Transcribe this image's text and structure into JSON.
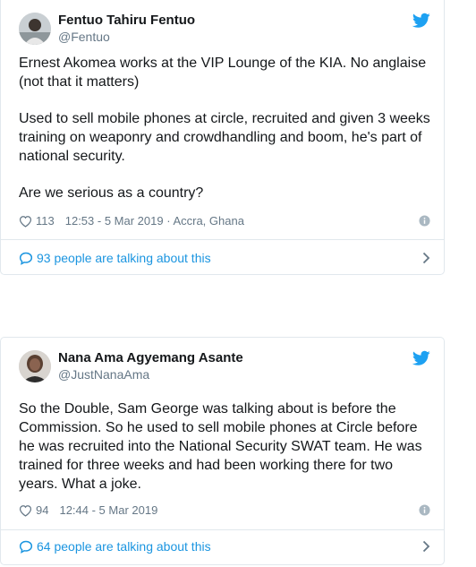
{
  "colors": {
    "link": "#1b95e0",
    "muted": "#657786",
    "text": "#14171a",
    "border": "#e1e8ed",
    "twitter_blue": "#1da1f2"
  },
  "tweets": [
    {
      "author_name": "Fentuo Tahiru Fentuo",
      "author_handle": "@Fentuo",
      "paragraphs": [
        "Ernest Akomea works at the VIP Lounge of the KIA. No anglaise (not that it matters)",
        "Used to sell mobile phones at circle,  recruited and given 3 weeks training on weaponry and crowdhandling and boom, he's part of national security.",
        "Are we serious as a country?"
      ],
      "likes": "113",
      "timestamp": "12:53 - 5 Mar 2019",
      "location": "· Accra, Ghana",
      "talking": "93 people are talking about this",
      "icons": [
        "heart-icon",
        "info-icon",
        "speech-bubble-icon",
        "chevron-right-icon",
        "twitter-bird-icon"
      ]
    },
    {
      "author_name": "Nana Ama Agyemang Asante",
      "author_handle": "@JustNanaAma",
      "paragraphs": [
        "So the Double, Sam George was talking about is before the Commission. So he used to sell mobile phones at Circle before he was recruited into the National Security SWAT team. He was trained for three weeks and had been working there for two years. What a joke."
      ],
      "likes": "94",
      "timestamp": "12:44 - 5 Mar 2019",
      "talking": "64 people are talking about this",
      "icons": [
        "heart-icon",
        "info-icon",
        "speech-bubble-icon",
        "chevron-right-icon",
        "twitter-bird-icon"
      ]
    }
  ]
}
